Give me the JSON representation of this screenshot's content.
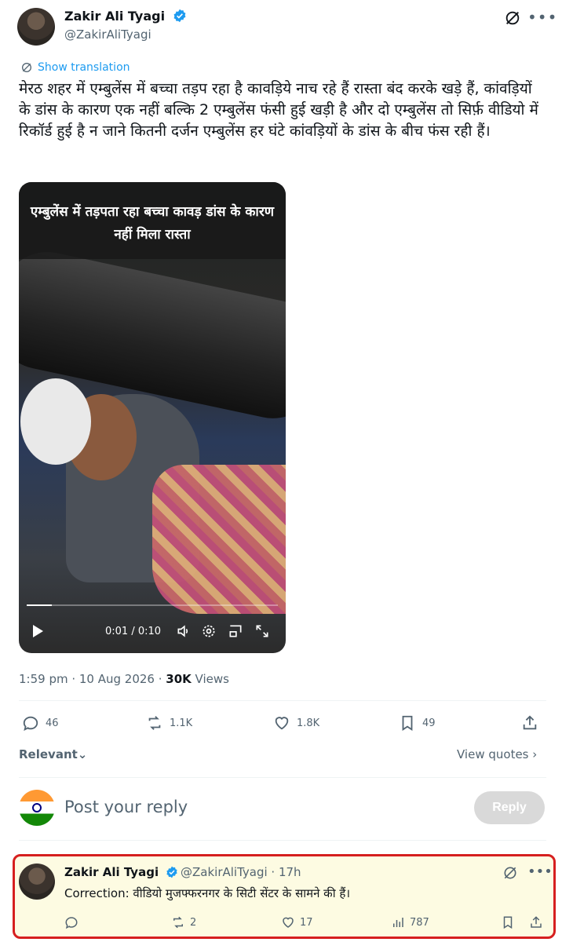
{
  "tweet": {
    "author_name": "Zakir Ali Tyagi",
    "author_handle": "@ZakirAliTyagi",
    "translate_label": "Show translation",
    "text": "मेरठ शहर में एम्बुलेंस में बच्चा तड़प रहा है कावड़िये नाच रहे हैं रास्ता बंद करके खड़े हैं, कांवड़ियों के डांस के कारण एक नहीं बल्कि 2 एम्बुलेंस फंसी हुई खड़ी है और दो एम्बुलेंस तो सिर्फ़ वीडियो में रिकॉर्ड हुई है न जाने कितनी दर्जन एम्बुलेंस हर घंटे कांवड़ियों के डांस के बीच फंस रही हैं।",
    "video": {
      "caption": "एम्बुलेंस में तड़पता रहा बच्चा कावड़ डांस के कारण नहीं मिला रास्ता",
      "time": "0:01 / 0:10",
      "progress": 0.1
    },
    "timestamp": "1:59 pm · 10 Aug 2026 · ",
    "views_count": "30K",
    "views_label": " Views",
    "actions": {
      "replies": "46",
      "reposts": "1.1K",
      "likes": "1.8K",
      "bookmarks": "49"
    }
  },
  "sort": {
    "label": "Relevant",
    "view_quotes": "View quotes"
  },
  "composer": {
    "placeholder": "Post your reply",
    "reply_button": "Reply"
  },
  "reply": {
    "author_name": "Zakir Ali Tyagi",
    "author_handle": "@ZakirAliTyagi · 17h",
    "text": "Correction: वीडियो मुजफ्फरनगर के सिटी सेंटर के सामने की हैं।",
    "actions": {
      "replies": "",
      "reposts": "2",
      "likes": "17",
      "views": "787"
    }
  },
  "colors": {
    "accent": "#1d9bf0",
    "highlight_border": "#d61f1f",
    "highlight_bg": "#fdfbe2",
    "muted": "#536471"
  }
}
